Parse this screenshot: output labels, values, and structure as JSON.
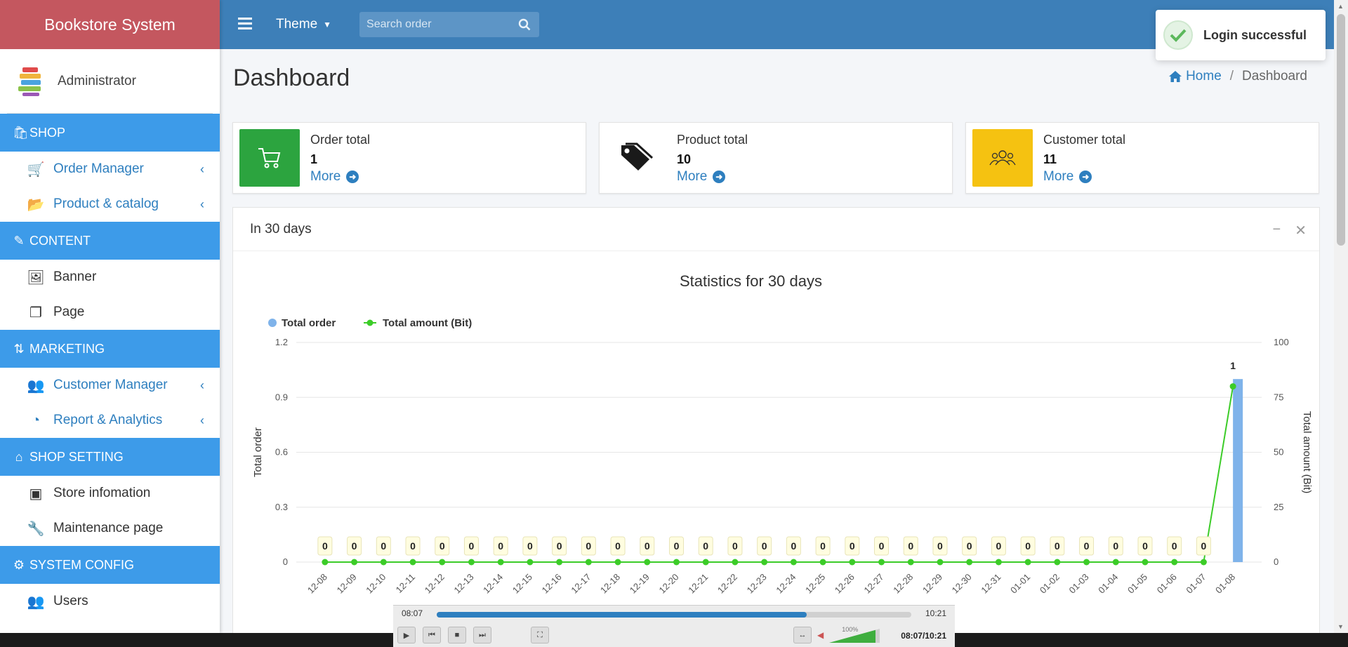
{
  "app": {
    "brand": "Bookstore System"
  },
  "user": {
    "name": "Administrator"
  },
  "sidebar": {
    "sections": [
      {
        "header": "SHOP",
        "icon": "shopify-icon",
        "items": [
          {
            "label": "Order Manager",
            "icon": "cart-icon",
            "expandable": true
          },
          {
            "label": "Product & catalog",
            "icon": "folder-open-icon",
            "expandable": true
          }
        ]
      },
      {
        "header": "CONTENT",
        "icon": "edit-icon",
        "items": [
          {
            "label": "Banner",
            "icon": "image-icon",
            "expandable": false
          },
          {
            "label": "Page",
            "icon": "copy-icon",
            "expandable": false
          }
        ]
      },
      {
        "header": "MARKETING",
        "icon": "sort-icon",
        "items": [
          {
            "label": "Customer Manager",
            "icon": "users-icon",
            "expandable": true
          },
          {
            "label": "Report & Analytics",
            "icon": "pie-chart-icon",
            "expandable": true
          }
        ]
      },
      {
        "header": "SHOP SETTING",
        "icon": "store-icon",
        "items": [
          {
            "label": "Store infomation",
            "icon": "hospital-icon",
            "expandable": false
          },
          {
            "label": "Maintenance page",
            "icon": "wrench-icon",
            "expandable": false
          }
        ]
      },
      {
        "header": "SYSTEM CONFIG",
        "icon": "cogs-icon",
        "items": [
          {
            "label": "Users",
            "icon": "users-icon",
            "expandable": false
          }
        ]
      }
    ]
  },
  "topbar": {
    "theme_label": "Theme",
    "search_placeholder": "Search order"
  },
  "page": {
    "title": "Dashboard",
    "breadcrumb_home": "Home",
    "breadcrumb_current": "Dashboard"
  },
  "info_boxes": [
    {
      "title": "Order total",
      "value": "1",
      "more": "More",
      "color": "#2ca43f"
    },
    {
      "title": "Product total",
      "value": "10",
      "more": "More",
      "color": "#ffffff"
    },
    {
      "title": "Customer total",
      "value": "11",
      "more": "More",
      "color": "#f5c211"
    }
  ],
  "card": {
    "title": "In 30 days"
  },
  "toast": {
    "message": "Login successful"
  },
  "media": {
    "elapsed": "08:07",
    "duration": "10:21",
    "position": "08:07/10:21",
    "volume": "100%",
    "progress": 0.78
  },
  "colors": {
    "accent": "#3d9be9",
    "topbar": "#3d7fb8",
    "brand": "#c4575f",
    "series_order": "#7fb3ea",
    "series_amount": "#3ccc28"
  },
  "chart_data": {
    "type": "bar",
    "title": "Statistics for 30 days",
    "categories": [
      "12-08",
      "12-09",
      "12-10",
      "12-11",
      "12-12",
      "12-13",
      "12-14",
      "12-15",
      "12-16",
      "12-17",
      "12-18",
      "12-19",
      "12-20",
      "12-21",
      "12-22",
      "12-23",
      "12-24",
      "12-25",
      "12-26",
      "12-27",
      "12-28",
      "12-29",
      "12-30",
      "12-31",
      "01-01",
      "01-02",
      "01-03",
      "01-04",
      "01-05",
      "01-06",
      "01-07",
      "01-08"
    ],
    "series": [
      {
        "name": "Total order",
        "type": "bar",
        "axis": "left",
        "values": [
          0,
          0,
          0,
          0,
          0,
          0,
          0,
          0,
          0,
          0,
          0,
          0,
          0,
          0,
          0,
          0,
          0,
          0,
          0,
          0,
          0,
          0,
          0,
          0,
          0,
          0,
          0,
          0,
          0,
          0,
          0,
          1
        ]
      },
      {
        "name": "Total amount (Bit)",
        "type": "line",
        "axis": "right",
        "values": [
          0,
          0,
          0,
          0,
          0,
          0,
          0,
          0,
          0,
          0,
          0,
          0,
          0,
          0,
          0,
          0,
          0,
          0,
          0,
          0,
          0,
          0,
          0,
          0,
          0,
          0,
          0,
          0,
          0,
          0,
          0,
          80
        ]
      }
    ],
    "data_labels": [
      "0",
      "0",
      "0",
      "0",
      "0",
      "0",
      "0",
      "0",
      "0",
      "0",
      "0",
      "0",
      "0",
      "0",
      "0",
      "0",
      "0",
      "0",
      "0",
      "0",
      "0",
      "0",
      "0",
      "0",
      "0",
      "0",
      "0",
      "0",
      "0",
      "0",
      "0",
      "1"
    ],
    "ylabel_left": "Total order",
    "ylabel_right": "Total amount (Bit)",
    "ylim_left": [
      0,
      1.2
    ],
    "yticks_left": [
      "0",
      "0.3",
      "0.6",
      "0.9",
      "1.2"
    ],
    "ylim_right": [
      0,
      100
    ],
    "yticks_right": [
      "0",
      "25",
      "50",
      "75",
      "100"
    ],
    "grid": true,
    "legend": "top-left"
  }
}
